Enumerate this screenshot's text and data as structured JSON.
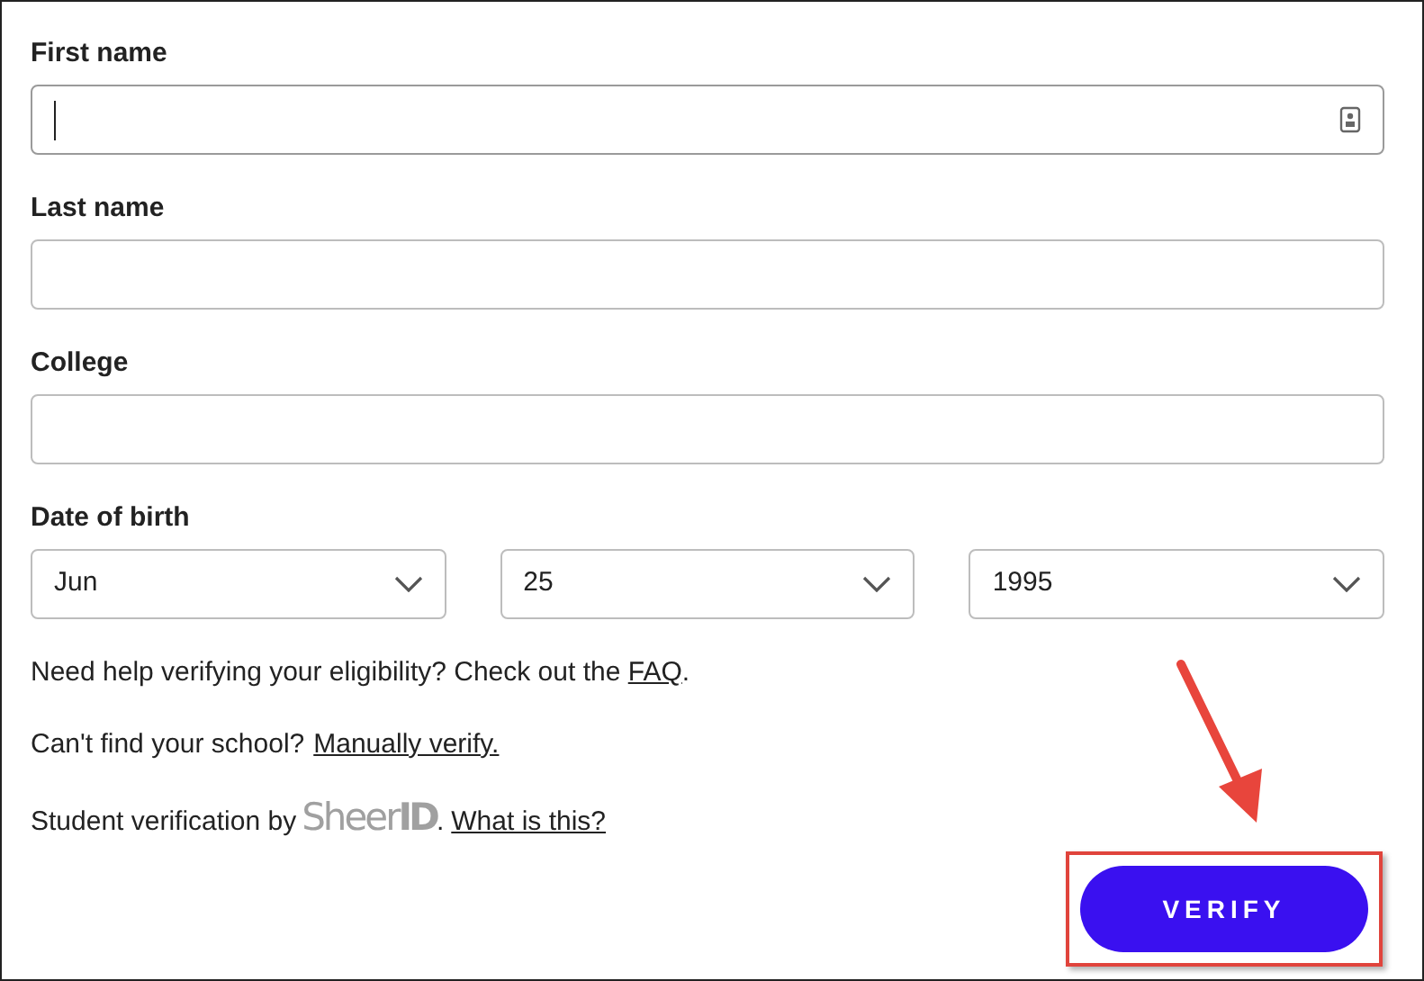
{
  "fields": [
    {
      "label": "First name",
      "kind": "text",
      "focused": true,
      "autofill_icon": true
    },
    {
      "label": "Last name",
      "kind": "text",
      "focused": false,
      "autofill_icon": false
    },
    {
      "label": "College",
      "kind": "text",
      "focused": false,
      "autofill_icon": false
    }
  ],
  "date_of_birth": {
    "label": "Date of birth",
    "selects": [
      {
        "value": "Jun"
      },
      {
        "value": "25"
      },
      {
        "value": "1995"
      }
    ]
  },
  "help_line": {
    "text": "Need help verifying your eligibility? Check out the ",
    "link": "FAQ",
    "after": "."
  },
  "school_line": {
    "text": "Can't find your school?",
    "link": "Manually verify."
  },
  "verification_line": {
    "text": "Student verification by",
    "logo": "Sheer",
    "logo_mark": "ID",
    "after": ".",
    "link": "What is this?"
  },
  "submit_button": {
    "label": "VERIFY"
  }
}
